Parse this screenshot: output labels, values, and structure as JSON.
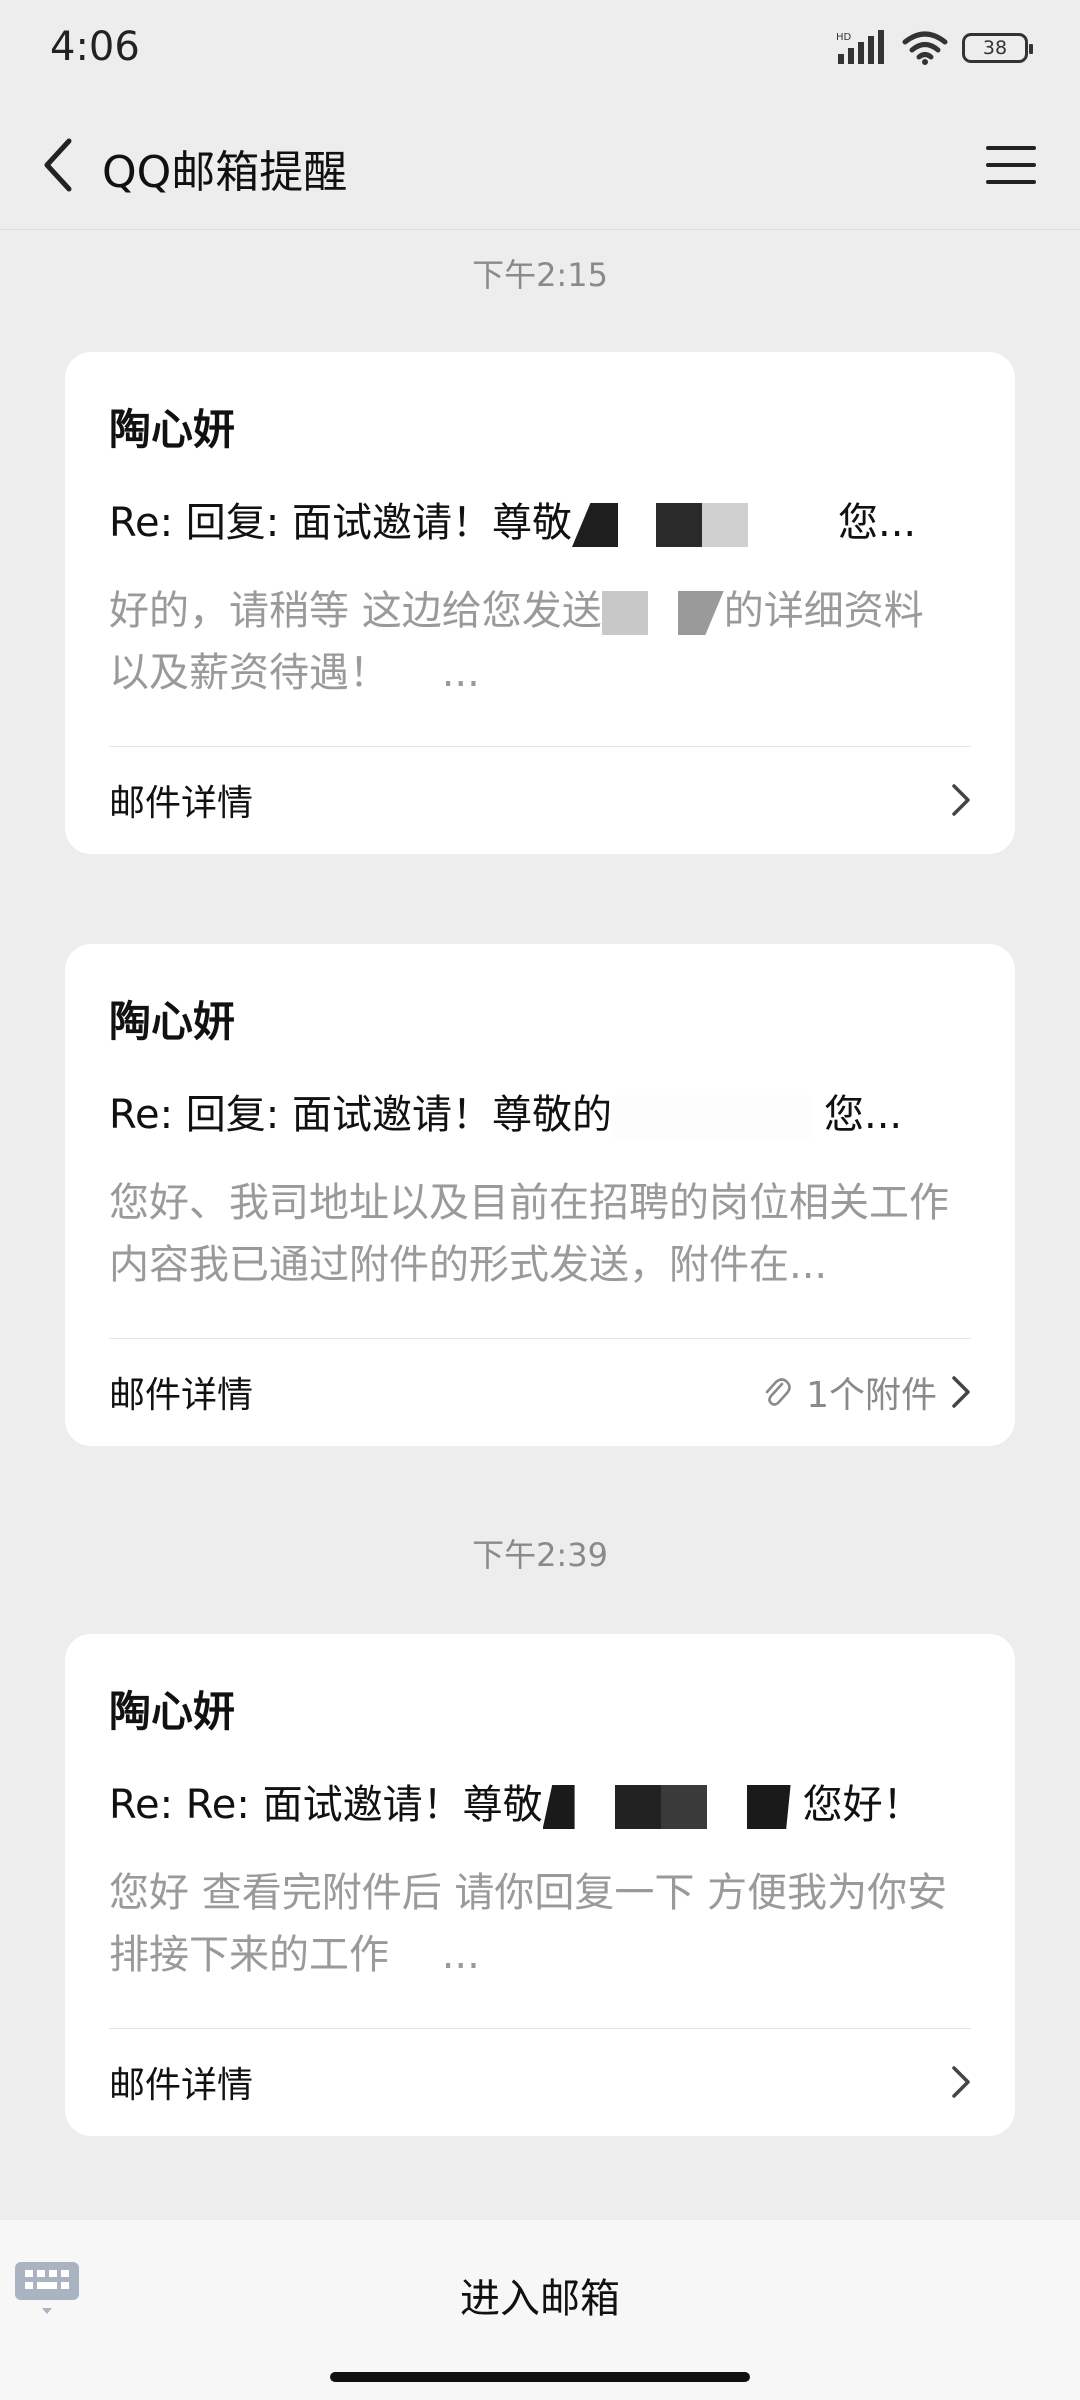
{
  "status_bar": {
    "time": "4:06",
    "battery": "38"
  },
  "header": {
    "title": "QQ邮箱提醒"
  },
  "groups": [
    {
      "time": "下午2:15",
      "messages": [
        {
          "sender": "陶心妍",
          "subject": "Re: 回复: 面试邀请！尊敬",
          "subject_end": "您...",
          "preview": "好的，请稍等 这边给您发送",
          "preview_mid": "的详细资料",
          "preview_line2": "以及薪资待遇！　 ...",
          "footer_label": "邮件详情"
        },
        {
          "sender": "陶心妍",
          "subject": "Re: 回复: 面试邀请！尊敬的",
          "subject_end": "您...",
          "preview": "您好、我司地址以及目前在招聘的岗位相关工作内容我已通过附件的形式发送，附件在...",
          "footer_label": "邮件详情",
          "attachment_text": "1个附件"
        }
      ]
    },
    {
      "time": "下午2:39",
      "messages": [
        {
          "sender": "陶心妍",
          "subject": "Re: Re: 面试邀请！尊敬",
          "subject_end": "您好！",
          "preview": "您好 查看完附件后 请你回复一下 方便我为你安排接下来的工作　 ...",
          "footer_label": "邮件详情"
        }
      ]
    }
  ],
  "bottom_bar": {
    "enter_mailbox": "进入邮箱"
  },
  "icons": {
    "back": "back-arrow-icon",
    "menu": "hamburger-menu-icon",
    "chevron": "chevron-right-icon",
    "attachment": "paperclip-icon",
    "keyboard": "keyboard-icon"
  },
  "colors": {
    "background": "#ededed",
    "card": "#ffffff",
    "muted_text": "#9a9a9a"
  }
}
